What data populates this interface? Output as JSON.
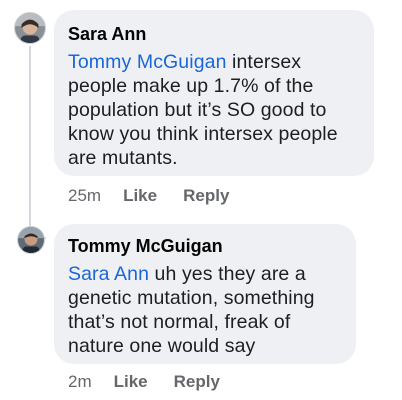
{
  "comments": [
    {
      "author": "Sara Ann",
      "mention": "Tommy McGuigan",
      "body": " intersex people make up 1.7% of the population but it’s SO good to know you think intersex people are mutants.",
      "time": "25m",
      "like_label": "Like",
      "reply_label": "Reply",
      "avatar": "profile-photo"
    },
    {
      "author": "Tommy McGuigan",
      "mention": "Sara Ann",
      "body": " uh yes they are a genetic mutation, something that’s not normal, freak of nature one would say",
      "time": "2m",
      "like_label": "Like",
      "reply_label": "Reply",
      "avatar": "profile-photo"
    }
  ],
  "colors": {
    "mention": "#1a66d6",
    "bubble": "#eef0f4",
    "meta": "#65676b"
  }
}
